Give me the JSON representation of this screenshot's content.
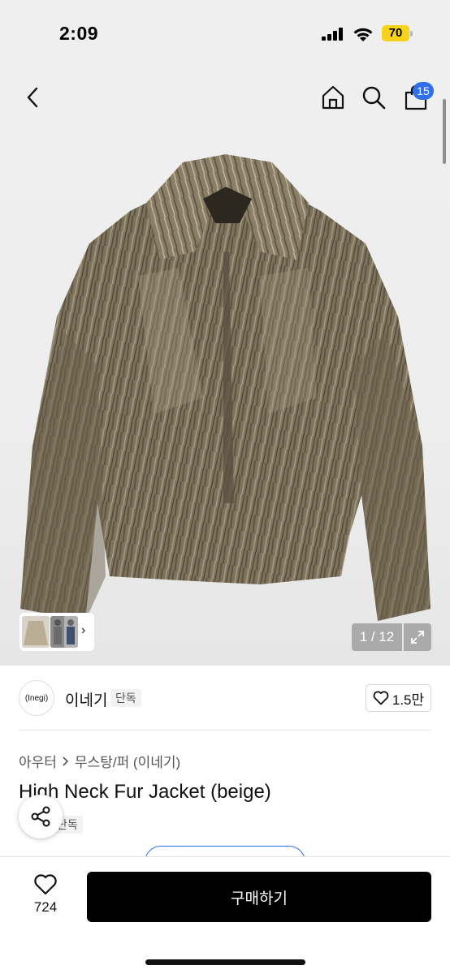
{
  "status_bar": {
    "time": "2:09",
    "battery": "70",
    "battery_color": "#f7d21b"
  },
  "header": {
    "back_icon": "chevron-left-icon",
    "home_icon": "home-icon",
    "search_icon": "search-icon",
    "cart_icon": "shopping-bag-icon",
    "cart_count": "15",
    "badge_color": "#2f6fe9"
  },
  "gallery": {
    "counter": "1 / 12",
    "expand_icon": "expand-icon",
    "thumbnail_arrow": "›"
  },
  "brand": {
    "logo_text": "(Inegi)",
    "name": "이네기",
    "tag": "단독",
    "likes": "1.5만"
  },
  "product": {
    "breadcrumb": [
      "아우터",
      "무스탕/퍼 (이네기)"
    ],
    "title": "High Neck Fur Jacket (beige)",
    "tag": "단독"
  },
  "bottom_bar": {
    "wish_count": "724",
    "buy_label": "구매하기"
  }
}
